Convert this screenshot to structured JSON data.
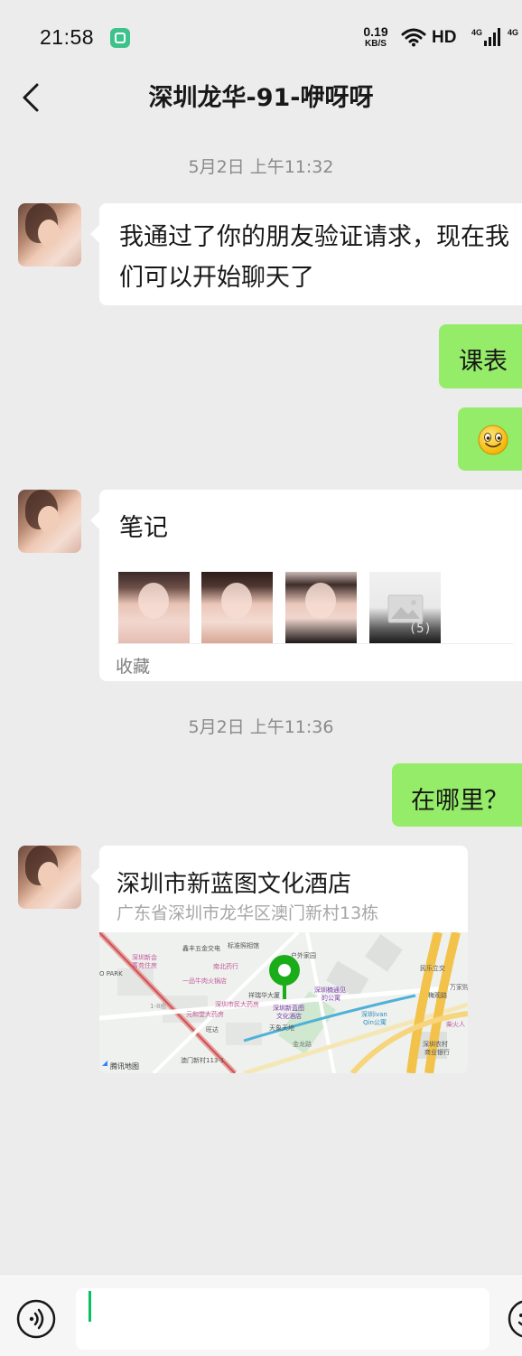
{
  "status_bar": {
    "time": "21:58",
    "net_speed_value": "0.19",
    "net_speed_unit": "KB/S",
    "hd_label": "HD",
    "network_label_1": "4G",
    "network_label_2": "4G"
  },
  "header": {
    "title": "深圳龙华-91-咿呀呀"
  },
  "messages": {
    "timestamp_1": "5月2日 上午11:32",
    "verify_text": "我通过了你的朋友验证请求，现在我们可以开始聊天了",
    "out_1": "课表",
    "note": {
      "title": "笔记",
      "more_count": "(5)",
      "source": "收藏"
    },
    "timestamp_2": "5月2日 上午11:36",
    "out_2": "在哪里？",
    "location": {
      "name": "深圳市新蓝图文化酒店",
      "address": "广东省深圳市龙华区澳门新村13栋",
      "map_labels": {
        "poi_1": "鑫丰五金交电",
        "poi_2": "标准照相馆",
        "poi_3": "户外家园",
        "poi_4": "深圳新会",
        "poi_5": "菁苑住房",
        "poi_6": "南北药行",
        "poi_7": "一品牛肉火锅店",
        "poi_8": "祥瑞华大厦",
        "poi_9": "深圳市民大药房",
        "poi_10": "元和堂大药房",
        "poi_11": "深圳新蓝图",
        "poi_12": "文化酒店",
        "poi_13": "旺达",
        "poi_14": "天象天地",
        "poi_15": "深圳楠通见",
        "poi_16": "的公寓",
        "poi_17": "深圳ivan",
        "poi_18": "Qin公寓",
        "poi_19": "民乐立交",
        "poi_20": "万家购",
        "poi_21": "梅观路",
        "poi_22": "柴火人",
        "poi_23": "深圳农村",
        "poi_24": "商业银行",
        "poi_25": "O PARK",
        "poi_26": "澳门新村113-1",
        "poi_27": "1-8栋",
        "poi_28": "腾讯地图",
        "poi_29": "金龙路"
      }
    }
  },
  "colors": {
    "background": "#ececec",
    "bubble_out": "#95ec69",
    "bubble_in": "#ffffff",
    "accent_green": "#07c160",
    "pin_green": "#1aad19"
  },
  "input_bar": {
    "value": ""
  }
}
